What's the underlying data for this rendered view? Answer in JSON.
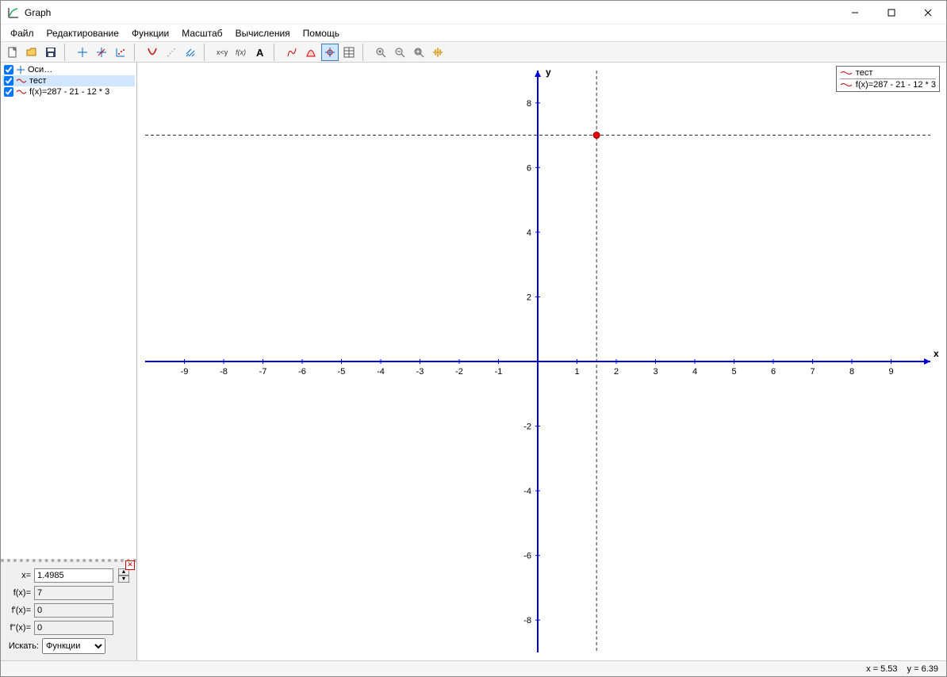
{
  "window": {
    "title": "Graph"
  },
  "menu": {
    "file": "Файл",
    "edit": "Редактирование",
    "functions": "Функции",
    "zoom": "Масштаб",
    "calc": "Вычисления",
    "help": "Помощь"
  },
  "tree": {
    "item_axes": "Оси…",
    "item_test": "тест",
    "item_fn": "f(x)=287 - 21 - 12 * 3"
  },
  "eval": {
    "x_label": "x=",
    "x_value": "1.4985",
    "fx_label": "f(x)=",
    "fx_value": "7",
    "f1x_label": "f'(x)=",
    "f1x_value": "0",
    "f2x_label": "f''(x)=",
    "f2x_value": "0",
    "search_label": "Искать:",
    "search_value": "Функции"
  },
  "legend": {
    "row1": "тест",
    "row2": "f(x)=287 - 21 - 12 * 3"
  },
  "status": {
    "x": "x = 5.53",
    "y": "y = 6.39"
  },
  "chart_data": {
    "type": "line",
    "title": "",
    "xlabel": "x",
    "ylabel": "y",
    "xlim": [
      -10,
      10
    ],
    "ylim": [
      -9,
      9
    ],
    "xticks": [
      -9,
      -8,
      -7,
      -6,
      -5,
      -4,
      -3,
      -2,
      -1,
      1,
      2,
      3,
      4,
      5,
      6,
      7,
      8,
      9
    ],
    "yticks": [
      -8,
      -6,
      -4,
      -2,
      2,
      4,
      6,
      8
    ],
    "series": [
      {
        "name": "тест",
        "constant_y": 7,
        "note": "horizontal dashed line at y=7"
      }
    ],
    "cursor": {
      "x": 1.4985,
      "y": 7
    },
    "crosshair_vertical_x": 1.4985
  }
}
